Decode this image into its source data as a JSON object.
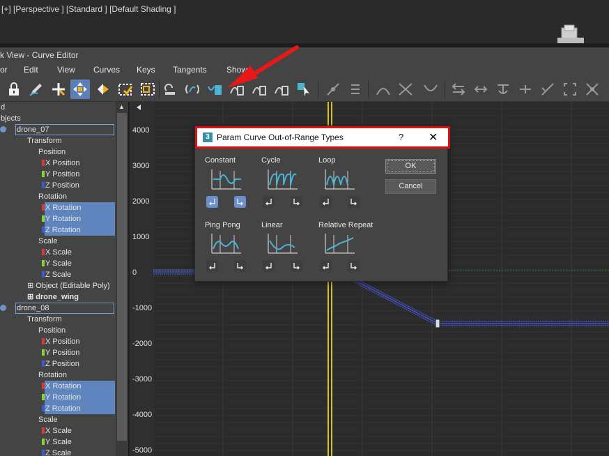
{
  "viewport": {
    "label": "[+] [Perspective ] [Standard ] [Default Shading ]"
  },
  "window": {
    "title": "k View - Curve Editor"
  },
  "menu": [
    "or",
    "Edit",
    "View",
    "Curves",
    "Keys",
    "Tangents",
    "Show"
  ],
  "toolbar": {
    "icons": [
      "lock-icon",
      "pencil-icon",
      "move-key-icon",
      "slide-keys-icon",
      "scale-keys-icon",
      "region-select-icon",
      "region-scale-icon",
      "param-out-of-range-icon",
      "ease-curve-icon",
      "multiplier-curve-icon",
      "filter-icon"
    ],
    "active": "slide-keys-icon",
    "accent": "#5c7fb7"
  },
  "tree": {
    "rows": [
      {
        "text": "d",
        "indent": 0
      },
      {
        "text": "bjects",
        "indent": 0
      },
      {
        "text": "drone_07",
        "indent": 1,
        "dot": true,
        "boxed": true
      },
      {
        "text": "Transform",
        "indent": 2
      },
      {
        "text": "Position",
        "indent": 3
      },
      {
        "text": "X Position",
        "indent": 4,
        "axis": "x"
      },
      {
        "text": "Y Position",
        "indent": 4,
        "axis": "y"
      },
      {
        "text": "Z Position",
        "indent": 4,
        "axis": "z"
      },
      {
        "text": "Rotation",
        "indent": 3
      },
      {
        "text": "X Rotation",
        "indent": 4,
        "axis": "x",
        "selected": true
      },
      {
        "text": "Y Rotation",
        "indent": 4,
        "axis": "y",
        "selected": true
      },
      {
        "text": "Z Rotation",
        "indent": 4,
        "axis": "z",
        "selected": true
      },
      {
        "text": "Scale",
        "indent": 3
      },
      {
        "text": "X Scale",
        "indent": 4,
        "axis": "x"
      },
      {
        "text": "Y Scale",
        "indent": 4,
        "axis": "y"
      },
      {
        "text": "Z Scale",
        "indent": 4,
        "axis": "z"
      },
      {
        "text": "⊞ Object (Editable Poly)",
        "indent": 2
      },
      {
        "text": "⊞ drone_wing",
        "indent": 2,
        "bold": true
      },
      {
        "text": "drone_08",
        "indent": 1,
        "dot": true,
        "boxed": true
      },
      {
        "text": "Transform",
        "indent": 2
      },
      {
        "text": "Position",
        "indent": 3
      },
      {
        "text": "X Position",
        "indent": 4,
        "axis": "x"
      },
      {
        "text": "Y Position",
        "indent": 4,
        "axis": "y"
      },
      {
        "text": "Z Position",
        "indent": 4,
        "axis": "z"
      },
      {
        "text": "Rotation",
        "indent": 3
      },
      {
        "text": "X Rotation",
        "indent": 4,
        "axis": "x",
        "selected": true
      },
      {
        "text": "Y Rotation",
        "indent": 4,
        "axis": "y",
        "selected": true
      },
      {
        "text": "Z Rotation",
        "indent": 4,
        "axis": "z",
        "selected": true
      },
      {
        "text": "Scale",
        "indent": 3
      },
      {
        "text": "X Scale",
        "indent": 4,
        "axis": "x"
      },
      {
        "text": "Y Scale",
        "indent": 4,
        "axis": "y"
      },
      {
        "text": "Z Scale",
        "indent": 4,
        "axis": "z"
      }
    ],
    "axis_colors": {
      "x": "#d23c3c",
      "y": "#8ad23c",
      "z": "#3c5ad2"
    }
  },
  "graph": {
    "y_labels": [
      "4000",
      "3000",
      "2000",
      "1000",
      "0",
      "-1000",
      "-2000",
      "-3000",
      "-4000",
      "-5000"
    ],
    "y_values": [
      4000,
      3000,
      2000,
      1000,
      0,
      -1000,
      -2000,
      -3000,
      -4000,
      -5000
    ],
    "curve_color": "#4a55d8",
    "time_slider_color": "#d8c020"
  },
  "dialog": {
    "title": "Param Curve Out-of-Range Types",
    "help": "?",
    "close": "✕",
    "types": [
      {
        "label": "Constant",
        "curve": "constant",
        "in_on": true,
        "out_on": true
      },
      {
        "label": "Cycle",
        "curve": "cycle",
        "in_on": false,
        "out_on": false
      },
      {
        "label": "Loop",
        "curve": "loop",
        "in_on": false,
        "out_on": false
      },
      {
        "label": "Ping Pong",
        "curve": "pingpong",
        "in_on": false,
        "out_on": false
      },
      {
        "label": "Linear",
        "curve": "linear",
        "in_on": false,
        "out_on": false
      },
      {
        "label": "Relative Repeat",
        "curve": "relrepeat",
        "in_on": false,
        "out_on": false
      }
    ],
    "ok": "OK",
    "cancel": "Cancel"
  },
  "annotation": {
    "color": "#e81818"
  }
}
